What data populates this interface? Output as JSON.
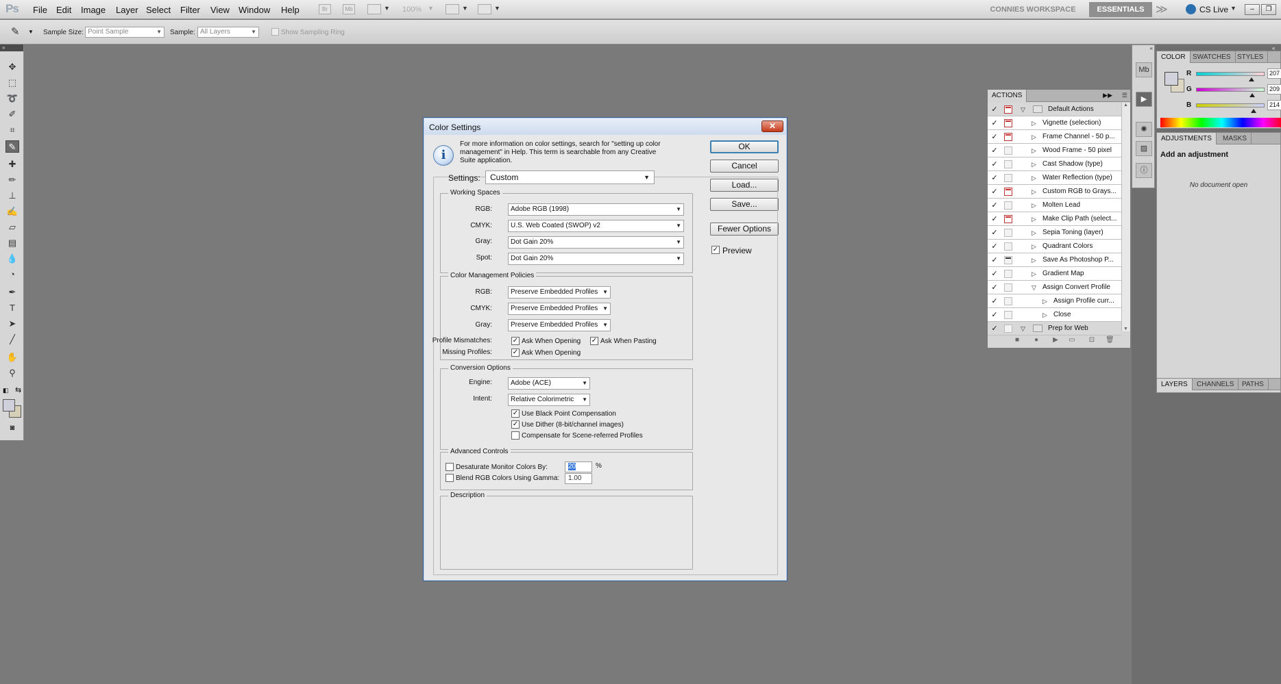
{
  "menubar": {
    "logo": "Ps",
    "menus": [
      "File",
      "Edit",
      "Image",
      "Layer",
      "Select",
      "Filter",
      "View",
      "Window",
      "Help"
    ],
    "zoom": "100%",
    "icon_br": "Br",
    "icon_mb": "Mb",
    "workspace_custom": "CONNIES WORKSPACE",
    "workspace_essentials": "ESSENTIALS",
    "more": "≫",
    "cs_live": "CS Live"
  },
  "options_bar": {
    "sample_size_label": "Sample Size:",
    "sample_size_value": "Point Sample",
    "sample_label": "Sample:",
    "sample_value": "All Layers",
    "sampling_ring_label": "Show Sampling Ring"
  },
  "color_panel": {
    "tabs": [
      "COLOR",
      "SWATCHES",
      "STYLES"
    ],
    "r_label": "R",
    "g_label": "G",
    "b_label": "B",
    "r_value": "207",
    "g_value": "209",
    "b_value": "214",
    "r_level": 207,
    "g_level": 209,
    "b_level": 214
  },
  "adjustments_panel": {
    "tabs": [
      "ADJUSTMENTS",
      "MASKS"
    ],
    "title": "Add an adjustment",
    "empty": "No document open"
  },
  "layers_panel": {
    "tabs": [
      "LAYERS",
      "CHANNELS",
      "PATHS"
    ]
  },
  "actions_panel": {
    "tab": "ACTIONS",
    "items": [
      {
        "label": "Default Actions",
        "level": 0,
        "folder": true,
        "expanded": true,
        "check": true,
        "dialog": "red"
      },
      {
        "label": "Vignette (selection)",
        "level": 1,
        "check": true,
        "dialog": "red"
      },
      {
        "label": "Frame Channel - 50 p...",
        "level": 1,
        "check": true,
        "dialog": "red"
      },
      {
        "label": "Wood Frame - 50 pixel",
        "level": 1,
        "check": true,
        "dialog": "none"
      },
      {
        "label": "Cast Shadow (type)",
        "level": 1,
        "check": true,
        "dialog": "none"
      },
      {
        "label": "Water Reflection (type)",
        "level": 1,
        "check": true,
        "dialog": "none"
      },
      {
        "label": "Custom RGB to Grays...",
        "level": 1,
        "check": true,
        "dialog": "red"
      },
      {
        "label": "Molten Lead",
        "level": 1,
        "check": true,
        "dialog": "none"
      },
      {
        "label": "Make Clip Path (select...",
        "level": 1,
        "check": true,
        "dialog": "red"
      },
      {
        "label": "Sepia Toning (layer)",
        "level": 1,
        "check": true,
        "dialog": "none"
      },
      {
        "label": "Quadrant Colors",
        "level": 1,
        "check": true,
        "dialog": "none"
      },
      {
        "label": "Save As Photoshop P...",
        "level": 1,
        "check": true,
        "dialog": "dark"
      },
      {
        "label": "Gradient Map",
        "level": 1,
        "check": true,
        "dialog": "none"
      },
      {
        "label": "Assign Convert Profile",
        "level": 1,
        "expanded": true,
        "check": true,
        "dialog": "none"
      },
      {
        "label": "Assign Profile curr...",
        "level": 2,
        "check": true,
        "dialog": "none"
      },
      {
        "label": "Close",
        "level": 2,
        "check": true,
        "dialog": "none"
      },
      {
        "label": "Prep for Web",
        "level": 0,
        "folder": true,
        "expanded": true,
        "check": true,
        "dialog": "none"
      }
    ]
  },
  "dialog": {
    "title": "Color Settings",
    "close": "✕",
    "info_icon": "i",
    "info_text": "For more information on color settings, search for \"setting up color management\" in Help. This term is searchable from any Creative Suite application.",
    "settings_label": "Settings:",
    "settings_value": "Custom",
    "buttons": {
      "ok": "OK",
      "cancel": "Cancel",
      "load": "Load...",
      "save": "Save...",
      "fewer": "Fewer Options"
    },
    "preview_label": "Preview",
    "working_spaces": {
      "legend": "Working Spaces",
      "rgb_label": "RGB:",
      "rgb_value": "Adobe RGB (1998)",
      "cmyk_label": "CMYK:",
      "cmyk_value": "U.S. Web Coated (SWOP) v2",
      "gray_label": "Gray:",
      "gray_value": "Dot Gain 20%",
      "spot_label": "Spot:",
      "spot_value": "Dot Gain 20%"
    },
    "policies": {
      "legend": "Color Management Policies",
      "rgb_label": "RGB:",
      "rgb_value": "Preserve Embedded Profiles",
      "cmyk_label": "CMYK:",
      "cmyk_value": "Preserve Embedded Profiles",
      "gray_label": "Gray:",
      "gray_value": "Preserve Embedded Profiles",
      "mismatch_label": "Profile Mismatches:",
      "ask_opening": "Ask When Opening",
      "ask_pasting": "Ask When Pasting",
      "missing_label": "Missing Profiles:",
      "missing_ask_opening": "Ask When Opening"
    },
    "conversion": {
      "legend": "Conversion Options",
      "engine_label": "Engine:",
      "engine_value": "Adobe (ACE)",
      "intent_label": "Intent:",
      "intent_value": "Relative Colorimetric",
      "bpc": "Use Black Point Compensation",
      "dither": "Use Dither (8-bit/channel images)",
      "scene": "Compensate for Scene-referred Profiles"
    },
    "advanced": {
      "legend": "Advanced Controls",
      "desat_label": "Desaturate Monitor Colors By:",
      "desat_value": "20",
      "desat_unit": "%",
      "blend_label": "Blend RGB Colors Using Gamma:",
      "blend_value": "1.00"
    },
    "description_legend": "Description",
    "check_mark": "✓"
  }
}
